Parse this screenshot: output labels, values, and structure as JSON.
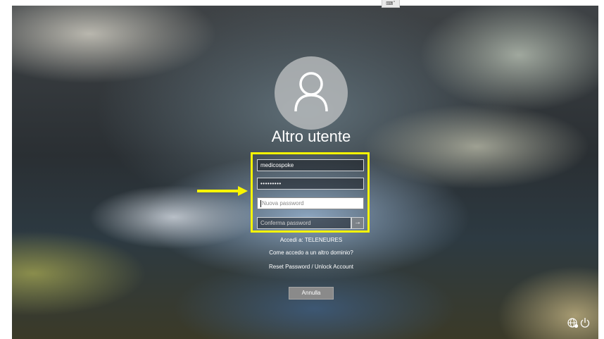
{
  "lock_screen": {
    "user_display_name": "Altro utente",
    "username_value": "medicospoke",
    "password_masked": "•••••••••",
    "new_password_placeholder": "Nuova password",
    "confirm_password_placeholder": "Conferma password",
    "submit_icon": "arrow-right-icon",
    "signin_to": "Accedi a: TELENEURES",
    "other_domain_link": "Come accedo a un altro dominio?",
    "reset_link": "Reset Password / Unlock Account",
    "cancel_label": "Annulla"
  },
  "annotation": {
    "highlight_color": "#f8f500",
    "arrow_color": "#f8f500"
  },
  "taskbar_icons": [
    "network-icon",
    "power-icon"
  ]
}
